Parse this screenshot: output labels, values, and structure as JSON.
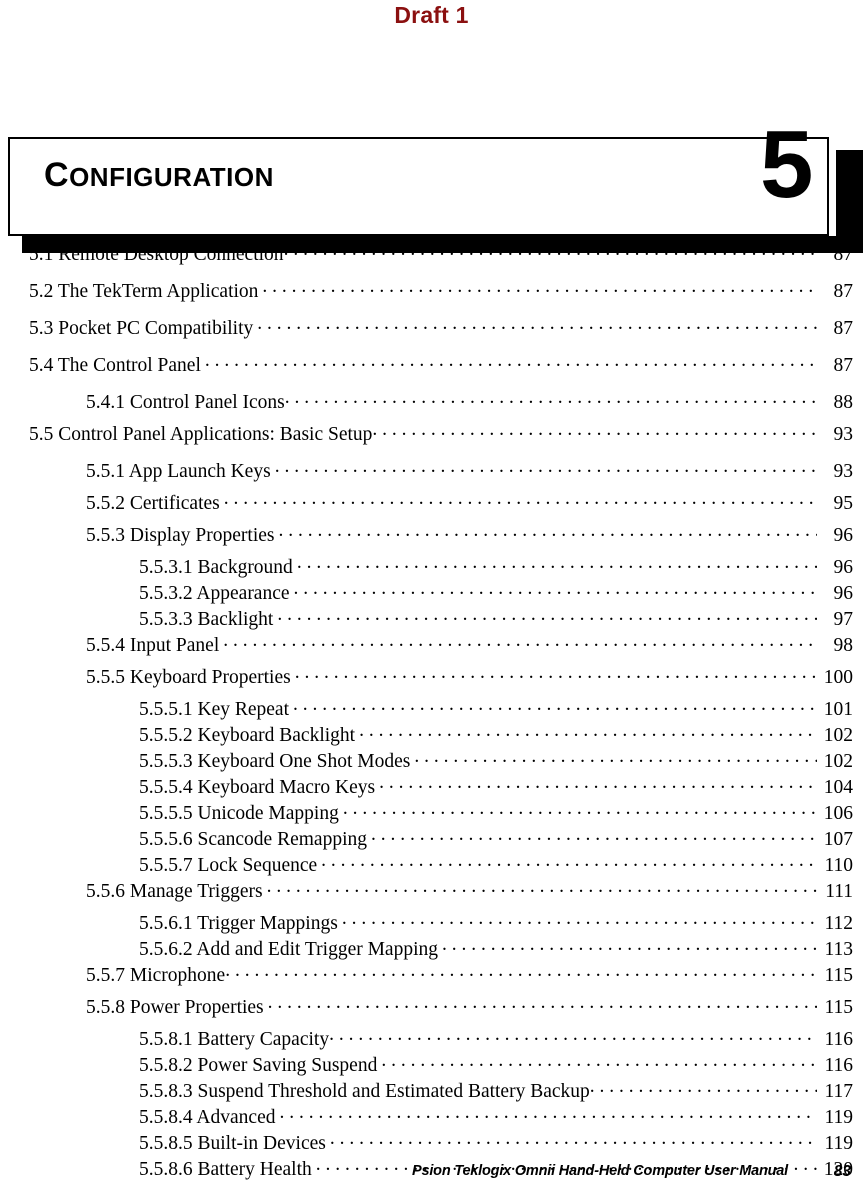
{
  "watermark": {
    "text": "Draft 1",
    "color": "#8b1010"
  },
  "chapter": {
    "title": "CONFIGURATION",
    "title_first_letter": "C",
    "title_rest": "ONFIGURATION",
    "number": "5"
  },
  "toc": {
    "entries": [
      {
        "level": 1,
        "label": "5.1 Remote Desktop Connection",
        "page": "87",
        "tight": true
      },
      {
        "level": 1,
        "label": "5.2 The TekTerm Application",
        "page": "87",
        "tight": false
      },
      {
        "level": 1,
        "label": "5.3 Pocket PC Compatibility",
        "page": "87",
        "tight": false
      },
      {
        "level": 1,
        "label": "5.4 The Control Panel",
        "page": "87",
        "tight": false
      },
      {
        "level": 2,
        "label": "5.4.1 Control Panel Icons",
        "page": "88",
        "tight": true
      },
      {
        "level": 1,
        "label": "5.5 Control Panel Applications: Basic Setup",
        "page": "93",
        "tight": true
      },
      {
        "level": 2,
        "label": "5.5.1 App Launch Keys",
        "page": "93",
        "tight": false
      },
      {
        "level": 2,
        "label": "5.5.2 Certificates",
        "page": "95",
        "tight": false
      },
      {
        "level": 2,
        "label": "5.5.3 Display Properties",
        "page": "96",
        "tight": false
      },
      {
        "level": 3,
        "label": "5.5.3.1 Background",
        "page": "96",
        "tight": false
      },
      {
        "level": 3,
        "label": "5.5.3.2 Appearance",
        "page": "96",
        "tight": false
      },
      {
        "level": 3,
        "label": "5.5.3.3 Backlight",
        "page": "97",
        "tight": false
      },
      {
        "level": 2,
        "label": "5.5.4 Input Panel",
        "page": "98",
        "tight": false
      },
      {
        "level": 2,
        "label": "5.5.5 Keyboard Properties",
        "page": "100",
        "tight": false
      },
      {
        "level": 3,
        "label": "5.5.5.1 Key Repeat",
        "page": "101",
        "tight": false
      },
      {
        "level": 3,
        "label": "5.5.5.2 Keyboard Backlight",
        "page": "102",
        "tight": false
      },
      {
        "level": 3,
        "label": "5.5.5.3 Keyboard One Shot Modes",
        "page": "102",
        "tight": false
      },
      {
        "level": 3,
        "label": "5.5.5.4 Keyboard Macro Keys",
        "page": "104",
        "tight": false
      },
      {
        "level": 3,
        "label": "5.5.5.5 Unicode Mapping",
        "page": "106",
        "tight": false
      },
      {
        "level": 3,
        "label": "5.5.5.6 Scancode Remapping",
        "page": "107",
        "tight": false
      },
      {
        "level": 3,
        "label": "5.5.5.7 Lock Sequence",
        "page": "110",
        "tight": false
      },
      {
        "level": 2,
        "label": "5.5.6 Manage Triggers",
        "page": "111",
        "tight": false
      },
      {
        "level": 3,
        "label": "5.5.6.1 Trigger Mappings",
        "page": "112",
        "tight": false
      },
      {
        "level": 3,
        "label": "5.5.6.2 Add and Edit Trigger Mapping",
        "page": "113",
        "tight": false
      },
      {
        "level": 2,
        "label": "5.5.7 Microphone",
        "page": "115",
        "tight": true
      },
      {
        "level": 2,
        "label": "5.5.8 Power Properties",
        "page": "115",
        "tight": false
      },
      {
        "level": 3,
        "label": "5.5.8.1 Battery Capacity",
        "page": "116",
        "tight": true
      },
      {
        "level": 3,
        "label": "5.5.8.2 Power Saving Suspend",
        "page": "116",
        "tight": false
      },
      {
        "level": 3,
        "label": "5.5.8.3 Suspend Threshold and Estimated Battery Backup",
        "page": "117",
        "tight": true
      },
      {
        "level": 3,
        "label": "5.5.8.4 Advanced",
        "page": "119",
        "tight": false
      },
      {
        "level": 3,
        "label": "5.5.8.5 Built-in Devices",
        "page": "119",
        "tight": false
      },
      {
        "level": 3,
        "label": "5.5.8.6 Battery Health",
        "page": "120",
        "tight": false
      }
    ]
  },
  "footer": {
    "text": "Psion Teklogix Omnii Hand-Held Computer User Manual",
    "page": "83"
  }
}
